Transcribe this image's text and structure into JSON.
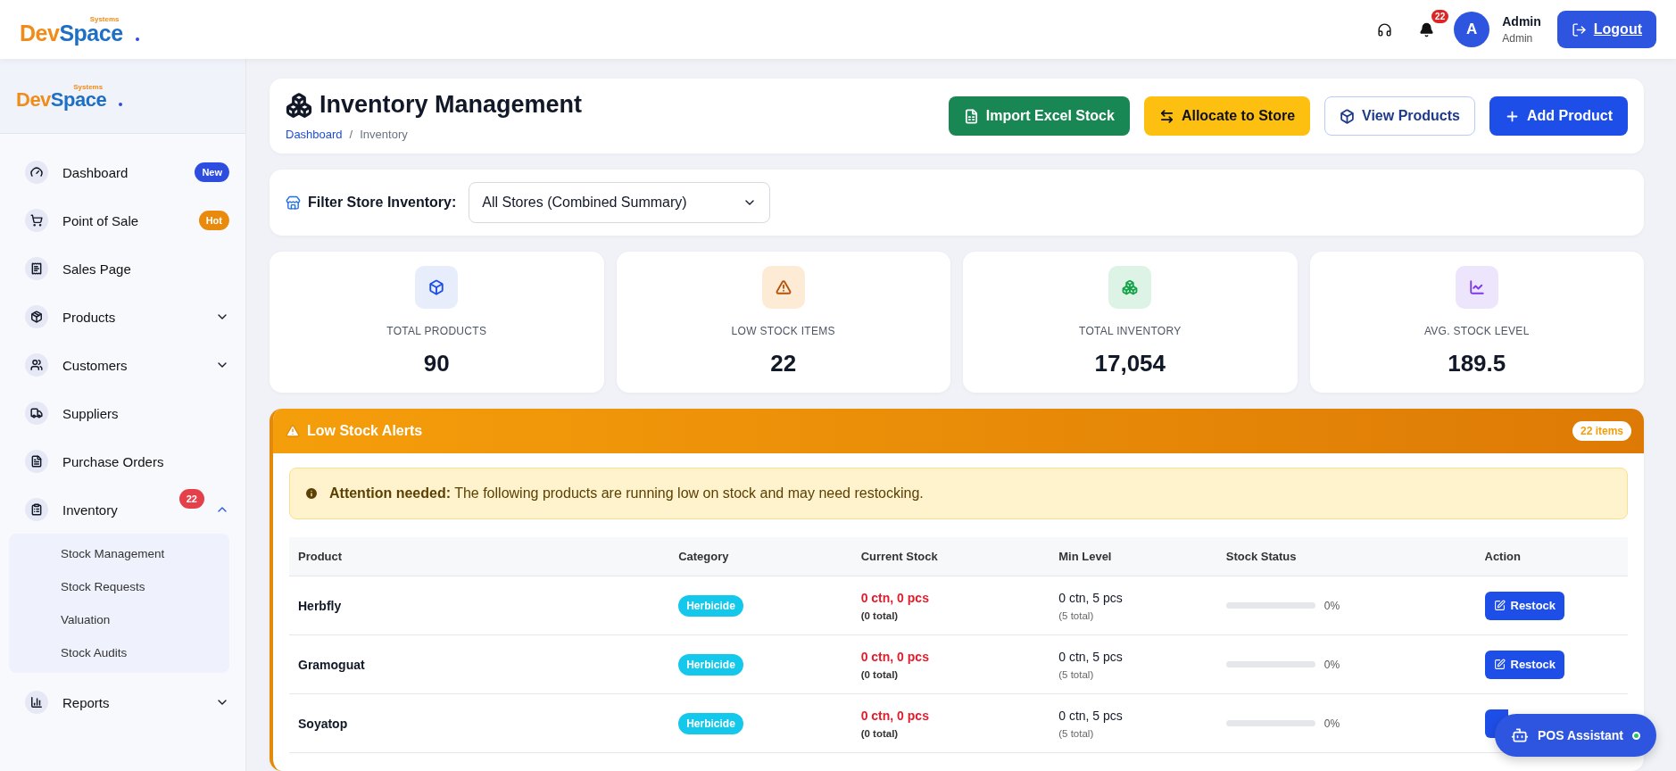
{
  "header": {
    "brand": {
      "part1": "Dev",
      "part2": "Space",
      "tagline": "Systems"
    },
    "notification_count": "22",
    "user": {
      "avatar_letter": "A",
      "name": "Admin",
      "role": "Admin"
    },
    "logout": "Logout"
  },
  "sidebar": {
    "brand": {
      "part1": "Dev",
      "part2": "Space",
      "tagline": "Systems"
    },
    "items": [
      {
        "label": "Dashboard",
        "badge": {
          "text": "New",
          "color": "#2d4de0"
        }
      },
      {
        "label": "Point of Sale",
        "badge": {
          "text": "Hot",
          "color": "#ea8a0c"
        }
      },
      {
        "label": "Sales Page"
      },
      {
        "label": "Products",
        "expanded": false
      },
      {
        "label": "Customers",
        "expanded": false
      },
      {
        "label": "Suppliers"
      },
      {
        "label": "Purchase Orders"
      },
      {
        "label": "Inventory",
        "badge": {
          "text": "22",
          "color": "#e5404a"
        },
        "expanded": true,
        "children": [
          {
            "label": "Stock Management"
          },
          {
            "label": "Stock Requests"
          },
          {
            "label": "Valuation"
          },
          {
            "label": "Stock Audits"
          }
        ]
      },
      {
        "label": "Reports",
        "expanded": false
      }
    ]
  },
  "page": {
    "title": "Inventory Management",
    "breadcrumb": {
      "link": "Dashboard",
      "separator": "/",
      "current": "Inventory"
    },
    "actions": [
      {
        "label": "Import Excel Stock",
        "kind": "excel"
      },
      {
        "label": "Allocate to Store",
        "kind": "allocate"
      },
      {
        "label": "View Products",
        "kind": "view"
      },
      {
        "label": "Add Product",
        "kind": "add"
      }
    ]
  },
  "filter": {
    "label": "Filter Store Inventory:",
    "value": "All Stores (Combined Summary)"
  },
  "stats": [
    {
      "label": "TOTAL PRODUCTS",
      "value": "90",
      "kind": "products"
    },
    {
      "label": "LOW STOCK ITEMS",
      "value": "22",
      "kind": "low"
    },
    {
      "label": "TOTAL INVENTORY",
      "value": "17,054",
      "kind": "inventory"
    },
    {
      "label": "AVG. STOCK LEVEL",
      "value": "189.5",
      "kind": "avg"
    }
  ],
  "alerts": {
    "title": "Low Stock Alerts",
    "count": "22 items",
    "notice": "**Attention needed:** The following products are running low on stock and may need restocking.",
    "columns": [
      "Product",
      "Category",
      "Current Stock",
      "Min Level",
      "Stock Status",
      "Action"
    ],
    "rows": [
      {
        "product": "Herbfly",
        "category": "Herbicide",
        "current": "0 ctn, 0 pcs",
        "current_total": "(0 total)",
        "min": "0 ctn, 5 pcs",
        "min_total": "(5 total)",
        "level": 0,
        "reading": "0%",
        "action": "Restock"
      },
      {
        "product": "Gramoguat",
        "category": "Herbicide",
        "current": "0 ctn, 0 pcs",
        "current_total": "(0 total)",
        "min": "0 ctn, 5 pcs",
        "min_total": "(5 total)",
        "level": 0,
        "reading": "0%",
        "action": "Restock"
      },
      {
        "product": "Soyatop",
        "category": "Herbicide",
        "current": "0 ctn, 0 pcs",
        "current_total": "(0 total)",
        "min": "0 ctn, 5 pcs",
        "min_total": "(5 total)",
        "level": 0,
        "reading": "0%"
      }
    ]
  },
  "assistant": {
    "label": "POS Assistant",
    "online": true
  }
}
